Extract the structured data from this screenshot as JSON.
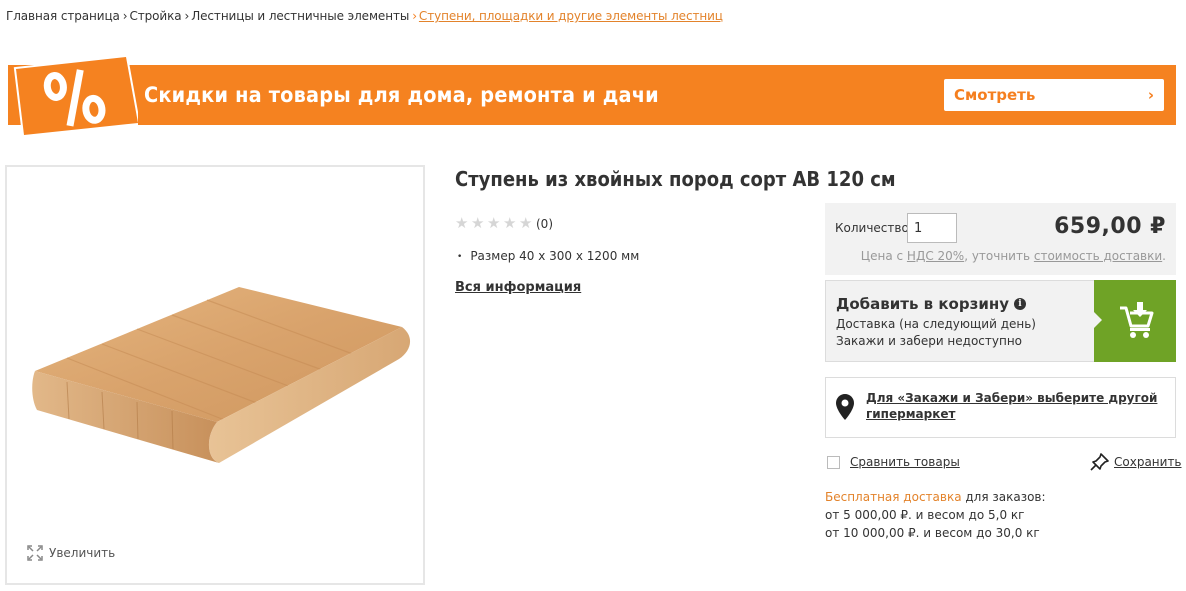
{
  "breadcrumb": [
    {
      "label": "Главная страница"
    },
    {
      "label": "Стройка"
    },
    {
      "label": "Лестницы и лестничные элементы"
    },
    {
      "label": "Ступени, площадки и другие элементы лестниц"
    }
  ],
  "promo": {
    "badge": "%",
    "text": "Скидки на товары для дома, ремонта и дачи",
    "button_label": "Смотреть",
    "button_chevron": "›",
    "color": "#f58220"
  },
  "gallery": {
    "zoom_label": "Увеличить",
    "zoom_icon": "expand-icon"
  },
  "product": {
    "title": "Ступень из хвойных пород сорт АВ 120 см",
    "rating": {
      "stars": 0,
      "max": 5,
      "reviews": "(0)"
    },
    "specs": [
      "Размер 40 х 300 х 1200 мм"
    ],
    "all_info_label": "Вся информация"
  },
  "buy": {
    "qty_label": "Количество",
    "qty_value": "1",
    "price": "659,00 ₽",
    "vat_prefix": "Цена с",
    "vat_link": "НДС 20%",
    "vat_middle": ", уточнить",
    "delivery_cost_link": "стоимость доставки",
    "vat_suffix": ".",
    "cart_title": "Добавить в корзину",
    "cart_info_icon": "info-icon",
    "cart_sub1": "Доставка (на следующий день)",
    "cart_sub2": "Закажи и забери недоступно",
    "cart_icon": "cart-add-icon",
    "cart_color": "#6fa326",
    "store_text": "Для «Закажи и Забери» выберите другой гипермаркет",
    "store_icon": "map-pin-icon",
    "compare_label": "Сравнить товары",
    "save_label": "Сохранить",
    "save_icon": "pin-icon",
    "delivery_free": "Бесплатная доставка",
    "delivery_rest": " для заказов:",
    "delivery_line2": "от 5 000,00 ₽. и весом до 5,0 кг",
    "delivery_line3": "от 10 000,00 ₽. и весом до 30,0 кг"
  }
}
